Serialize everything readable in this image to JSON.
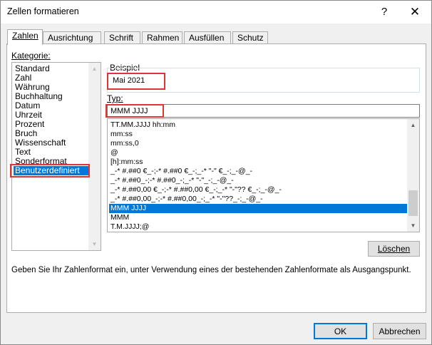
{
  "window": {
    "title": "Zellen formatieren",
    "help_icon": "?",
    "close_icon": "✕"
  },
  "tabs": [
    {
      "label": "Zahlen",
      "active": true
    },
    {
      "label": "Ausrichtung",
      "active": false
    },
    {
      "label": "Schrift",
      "active": false
    },
    {
      "label": "Rahmen",
      "active": false
    },
    {
      "label": "Ausfüllen",
      "active": false
    },
    {
      "label": "Schutz",
      "active": false
    }
  ],
  "category": {
    "label": "Kategorie:",
    "items": [
      "Standard",
      "Zahl",
      "Währung",
      "Buchhaltung",
      "Datum",
      "Uhrzeit",
      "Prozent",
      "Bruch",
      "Wissenschaft",
      "Text",
      "Sonderformat",
      "Benutzerdefiniert"
    ],
    "selected": "Benutzerdefiniert"
  },
  "sample": {
    "label": "Beispiel",
    "value": "Mai 2021"
  },
  "type": {
    "label": "Typ:",
    "value": "MMM JJJJ",
    "items": [
      "TT.MM.JJJJ hh:mm",
      "mm:ss",
      "mm:ss,0",
      "@",
      "[h]:mm:ss",
      "_-* #.##0 €_-;-* #.##0 €_-;_-* \"-\" €_-;_-@_-",
      "_-* #.##0_-;-* #.##0_-;_-* \"-\"_-;_-@_-",
      "_-* #.##0,00 €_-;-* #.##0,00 €_-;_-* \"-\"?? €_-;_-@_-",
      "_-* #.##0,00_-;-* #.##0,00_-;_-* \"-\"??_-;_-@_-",
      "MMM JJJJ",
      "MMM",
      "T.M.JJJJ;@"
    ],
    "selected": "MMM JJJJ"
  },
  "delete_button": "Löschen",
  "description": "Geben Sie Ihr Zahlenformat ein, unter Verwendung eines der bestehenden Zahlenformate als Ausgangspunkt.",
  "footer": {
    "ok": "OK",
    "cancel": "Abbrechen"
  },
  "colors": {
    "selection": "#0078d7",
    "highlight_box": "#e03535"
  },
  "icons": {
    "scroll_up": "scroll-up-arrow-icon",
    "scroll_down": "scroll-down-arrow-icon"
  }
}
